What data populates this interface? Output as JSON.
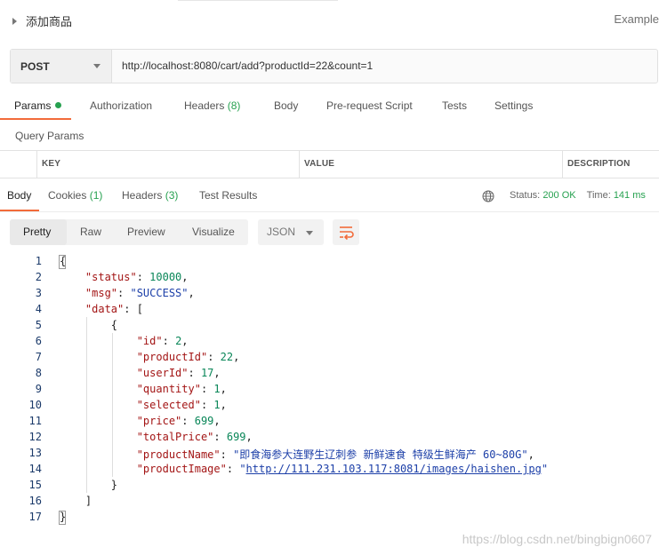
{
  "header": {
    "title": "添加商品",
    "right_text": "Example"
  },
  "request": {
    "method": "POST",
    "url": "http://localhost:8080/cart/add?productId=22&count=1"
  },
  "request_tabs": [
    {
      "label": "Params",
      "active": true
    },
    {
      "label": "Authorization"
    },
    {
      "label": "Headers",
      "count": "(8)"
    },
    {
      "label": "Body"
    },
    {
      "label": "Pre-request Script"
    },
    {
      "label": "Tests"
    },
    {
      "label": "Settings"
    }
  ],
  "query_params": {
    "label": "Query Params",
    "columns": [
      "KEY",
      "VALUE",
      "DESCRIPTION"
    ]
  },
  "response_tabs": [
    {
      "label": "Body",
      "active": true
    },
    {
      "label": "Cookies",
      "count": "(1)"
    },
    {
      "label": "Headers",
      "count": "(3)"
    },
    {
      "label": "Test Results"
    }
  ],
  "response_meta": {
    "status_label": "Status:",
    "status_value": "200 OK",
    "time_label": "Time:",
    "time_value": "141 ms"
  },
  "view_modes": [
    "Pretty",
    "Raw",
    "Preview",
    "Visualize"
  ],
  "format": "JSON",
  "code_lines": [
    "{",
    "    \"status\": 10000,",
    "    \"msg\": \"SUCCESS\",",
    "    \"data\": [",
    "        {",
    "            \"id\": 2,",
    "            \"productId\": 22,",
    "            \"userId\": 17,",
    "            \"quantity\": 1,",
    "            \"selected\": 1,",
    "            \"price\": 699,",
    "            \"totalPrice\": 699,",
    "            \"productName\": \"即食海参大连野生辽刺参 新鲜速食 特级生鲜海产 60~80G\",",
    "            \"productImage\": \"http://111.231.103.117:8081/images/haishen.jpg\"",
    "        }",
    "    ]",
    "}"
  ],
  "watermark": "https://blog.csdn.net/bingbign0607"
}
